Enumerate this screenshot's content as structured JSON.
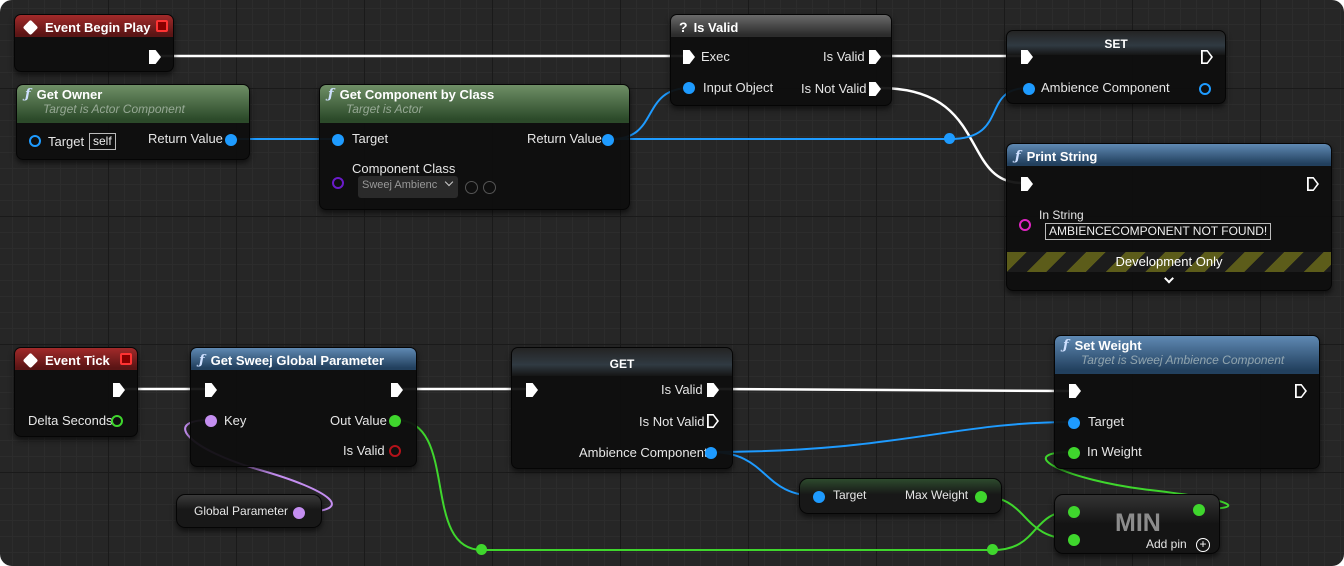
{
  "nodes": {
    "event_begin_play": {
      "title": "Event Begin Play"
    },
    "get_owner": {
      "title": "Get Owner",
      "subtitle": "Target is Actor Component",
      "target_label": "Target",
      "target_value": "self",
      "return_label": "Return Value"
    },
    "get_component_by_class": {
      "title": "Get Component by Class",
      "subtitle": "Target is Actor",
      "target_label": "Target",
      "return_label": "Return Value",
      "class_label": "Component Class",
      "class_value": "Sweej Ambienc"
    },
    "is_valid": {
      "title": "Is Valid",
      "exec_label": "Exec",
      "is_valid_label": "Is Valid",
      "input_label": "Input Object",
      "not_valid_label": "Is Not Valid"
    },
    "set": {
      "title": "SET",
      "var_label": "Ambience Component"
    },
    "print_string": {
      "title": "Print String",
      "in_string_label": "In String",
      "in_string_value": "AMBIENCECOMPONENT NOT FOUND!",
      "dev_label": "Development Only"
    },
    "event_tick": {
      "title": "Event Tick",
      "delta_label": "Delta Seconds"
    },
    "get_sweej_param": {
      "title": "Get Sweej Global Parameter",
      "key_label": "Key",
      "out_label": "Out Value",
      "valid_label": "Is Valid"
    },
    "get": {
      "title": "GET",
      "valid_label": "Is Valid",
      "not_valid_label": "Is Not Valid",
      "var_label": "Ambience Component"
    },
    "set_weight": {
      "title": "Set Weight",
      "subtitle": "Target is Sweej Ambience Component",
      "target_label": "Target",
      "weight_label": "In Weight"
    },
    "global_param": {
      "label": "Global Parameter"
    },
    "max_weight": {
      "target_label": "Target",
      "value_label": "Max Weight"
    },
    "min": {
      "title": "MIN",
      "add_pin_label": "Add pin"
    }
  },
  "icons": {
    "event": "diamond-event-icon",
    "function": "function-f-icon",
    "question": "question-icon",
    "stop": "stop-square-icon",
    "add": "plus-circle-icon",
    "chevron": "chevron-down-icon"
  },
  "colors": {
    "exec": "#ffffff",
    "object": "#1e9bff",
    "float": "#3fd62d",
    "struct": "#c48ef0",
    "string": "#e024c2",
    "bool": "#b3121a",
    "class": "#6a1bc9"
  }
}
